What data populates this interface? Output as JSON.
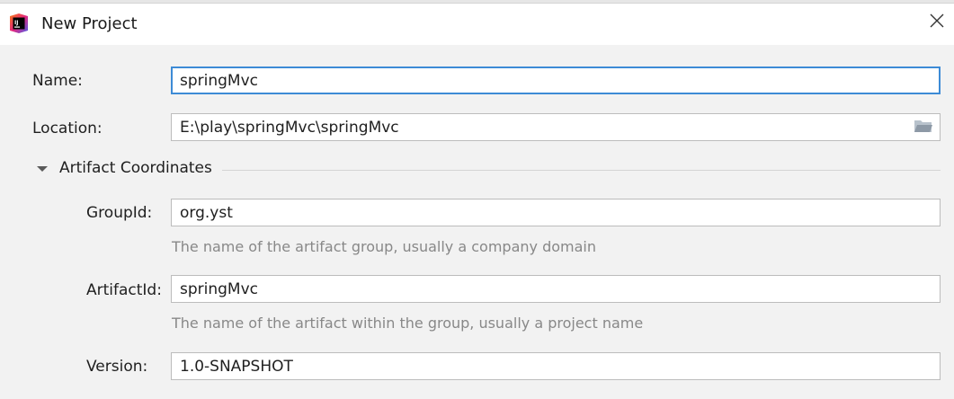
{
  "window": {
    "title": "New Project",
    "app_icon": "intellij-icon",
    "close_icon": "close-icon"
  },
  "form": {
    "name": {
      "label": "Name:",
      "value": "springMvc"
    },
    "location": {
      "label": "Location:",
      "value": "E:\\play\\springMvc\\springMvc",
      "browse_icon": "folder-icon"
    },
    "artifact_section": {
      "title": "Artifact Coordinates",
      "expanded": true,
      "toggle_icon": "triangle-down-icon"
    },
    "group_id": {
      "label": "GroupId:",
      "value": "org.yst",
      "hint": "The name of the artifact group, usually a company domain"
    },
    "artifact_id": {
      "label": "ArtifactId:",
      "value": "springMvc",
      "hint": "The name of the artifact within the group, usually a project name"
    },
    "version": {
      "label": "Version:",
      "value": "1.0-SNAPSHOT"
    }
  },
  "colors": {
    "focus_border": "#3d8bd6",
    "hint_text": "#888888",
    "background": "#f2f2f2"
  }
}
